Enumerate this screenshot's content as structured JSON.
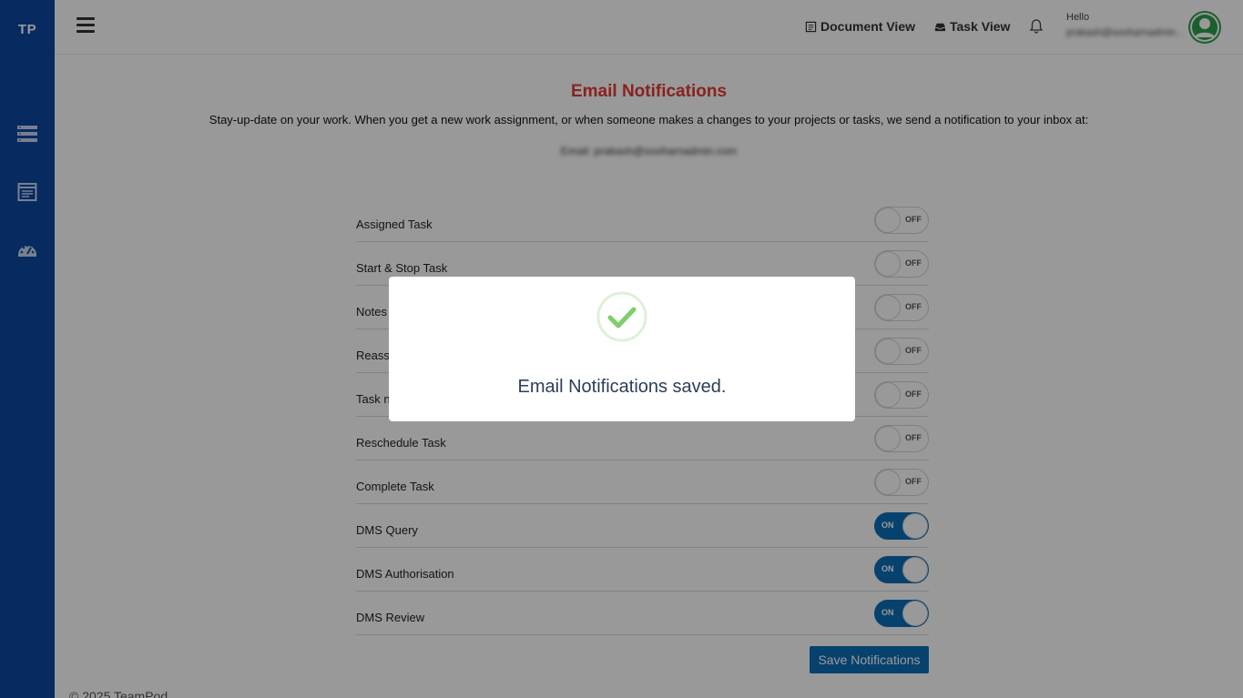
{
  "app": {
    "logo": "TP"
  },
  "sidebar": {
    "items": [
      {
        "icon": "server-list-icon"
      },
      {
        "icon": "calendar-list-icon"
      },
      {
        "icon": "dashboard-gauge-icon"
      }
    ]
  },
  "header": {
    "document_view": "Document View",
    "task_view": "Task View",
    "hello": "Hello",
    "user_email": "prakash@sooharnadmin..."
  },
  "page": {
    "title": "Email Notifications",
    "subtitle": "Stay-up-date on your work. When you get a new work assignment, or when someone makes a changes to your projects or tasks, we send a notification to your inbox at:",
    "email_line": "Email: prakash@sooharnadmin.com"
  },
  "notifications": [
    {
      "label": "Assigned Task",
      "state": "OFF"
    },
    {
      "label": "Start & Stop Task",
      "state": "OFF"
    },
    {
      "label": "Notes",
      "state": "OFF"
    },
    {
      "label": "Reass",
      "state": "OFF"
    },
    {
      "label": "Task n",
      "state": "OFF"
    },
    {
      "label": "Reschedule Task",
      "state": "OFF"
    },
    {
      "label": "Complete Task",
      "state": "OFF"
    },
    {
      "label": "DMS Query",
      "state": "ON"
    },
    {
      "label": "DMS Authorisation",
      "state": "ON"
    },
    {
      "label": "DMS Review",
      "state": "ON"
    }
  ],
  "save_button": "Save Notifications",
  "footer": "© 2025 TeamPod",
  "modal": {
    "message": "Email Notifications saved."
  },
  "colors": {
    "sidebar": "#0d47a1",
    "accent": "#0d6fb8",
    "title": "#e53935",
    "success": "#7ccf6a"
  }
}
